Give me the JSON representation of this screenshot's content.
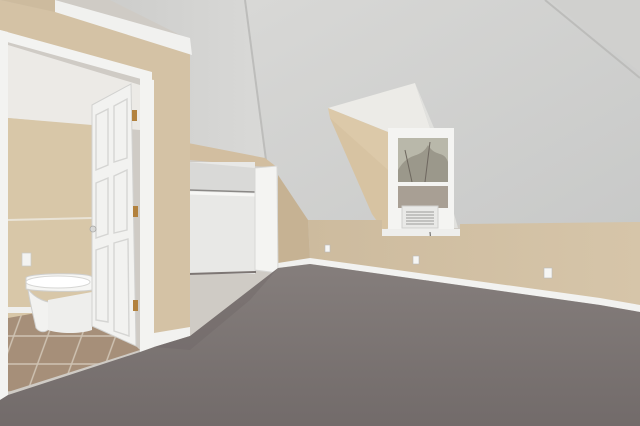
{
  "scene": {
    "kind": "photo",
    "subject": "attic-bedroom",
    "colors": {
      "ceiling": "#d3d3d1",
      "ceiling_shade": "#c4c5c4",
      "wall_tan": "#d7c6aa",
      "wall_tan_shade": "#c9b79b",
      "trim": "#f3f3f1",
      "carpet": "#7e7776",
      "carpet_dark": "#6c6564",
      "bath_floor": "#a58e78",
      "door_white": "#f1f1ef",
      "window_glass": "#b8b7a8"
    }
  }
}
